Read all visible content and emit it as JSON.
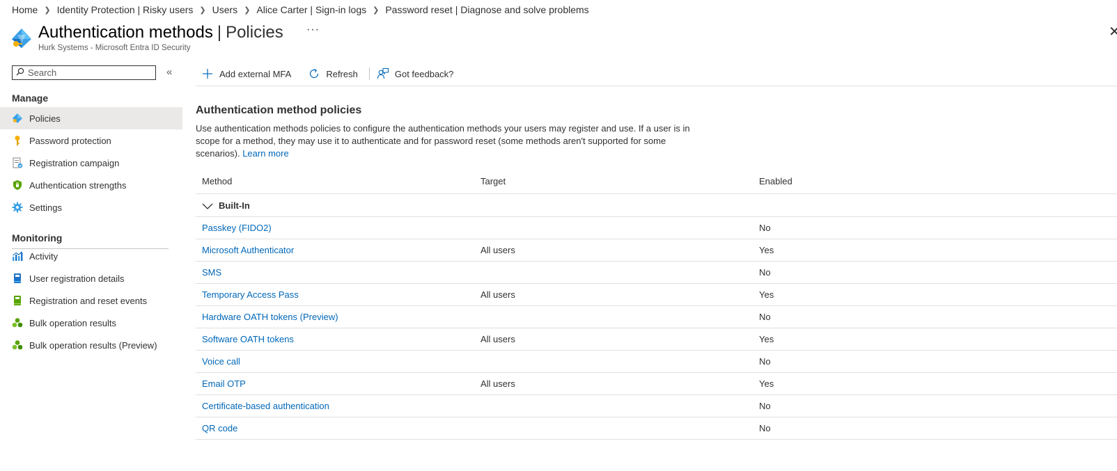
{
  "breadcrumb": [
    "Home",
    "Identity Protection | Risky users",
    "Users",
    "Alice Carter | Sign-in logs",
    "Password reset | Diagnose and solve problems"
  ],
  "header": {
    "title": "Authentication methods",
    "title_suffix": "Policies",
    "more": "···",
    "subtitle": "Hurk Systems - Microsoft Entra ID Security",
    "close": "✕"
  },
  "sidebar": {
    "search_placeholder": "Search",
    "collapse": "«",
    "manage_title": "Manage",
    "manage_items": [
      {
        "label": "Policies",
        "icon": "policies-icon",
        "active": true
      },
      {
        "label": "Password protection",
        "icon": "key-icon"
      },
      {
        "label": "Registration campaign",
        "icon": "registration-campaign-icon"
      },
      {
        "label": "Authentication strengths",
        "icon": "shield-icon"
      },
      {
        "label": "Settings",
        "icon": "gear-icon"
      }
    ],
    "monitoring_title": "Monitoring",
    "monitoring_items": [
      {
        "label": "Activity",
        "icon": "activity-chart-icon"
      },
      {
        "label": "User registration details",
        "icon": "user-details-book-icon"
      },
      {
        "label": "Registration and reset events",
        "icon": "events-book-icon"
      },
      {
        "label": "Bulk operation results",
        "icon": "bulk-operation-icon"
      },
      {
        "label": "Bulk operation results (Preview)",
        "icon": "bulk-operation-preview-icon"
      }
    ]
  },
  "toolbar": {
    "add_external_mfa": "Add external MFA",
    "refresh": "Refresh",
    "feedback": "Got feedback?"
  },
  "content": {
    "section_title": "Authentication method policies",
    "description": "Use authentication methods policies to configure the authentication methods your users may register and use. If a user is in scope for a method, they may use it to authenticate and for password reset (some methods aren't supported for some scenarios).",
    "learn_more": "Learn more",
    "columns": {
      "method": "Method",
      "target": "Target",
      "enabled": "Enabled"
    },
    "group_label": "Built-In",
    "rows": [
      {
        "method": "Passkey (FIDO2)",
        "target": "",
        "enabled": "No"
      },
      {
        "method": "Microsoft Authenticator",
        "target": "All users",
        "enabled": "Yes"
      },
      {
        "method": "SMS",
        "target": "",
        "enabled": "No"
      },
      {
        "method": "Temporary Access Pass",
        "target": "All users",
        "enabled": "Yes"
      },
      {
        "method": "Hardware OATH tokens (Preview)",
        "target": "",
        "enabled": "No"
      },
      {
        "method": "Software OATH tokens",
        "target": "All users",
        "enabled": "Yes"
      },
      {
        "method": "Voice call",
        "target": "",
        "enabled": "No"
      },
      {
        "method": "Email OTP",
        "target": "All users",
        "enabled": "Yes"
      },
      {
        "method": "Certificate-based authentication",
        "target": "",
        "enabled": "No"
      },
      {
        "method": "QR code",
        "target": "",
        "enabled": "No"
      }
    ]
  },
  "colors": {
    "link": "#0067b8",
    "active_nav": "#ebe9e7",
    "divider": "#e1dfdd"
  }
}
